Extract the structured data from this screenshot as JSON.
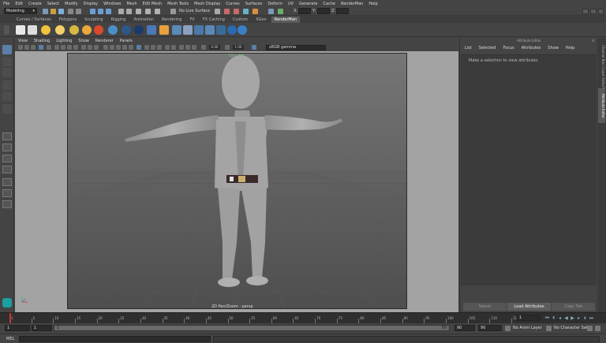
{
  "menubar": [
    "File",
    "Edit",
    "Create",
    "Select",
    "Modify",
    "Display",
    "Windows",
    "Mesh",
    "Edit Mesh",
    "Mesh Tools",
    "Mesh Display",
    "Curves",
    "Surfaces",
    "Deform",
    "UV",
    "Generate",
    "Cache",
    "RenderMan",
    "Help"
  ],
  "statusline": {
    "mode": "Modeling",
    "live_surface": "No Live Surface",
    "x_label": "X:",
    "y_label": "Y:",
    "z_label": "Z:"
  },
  "shelf": {
    "tabs": [
      "Curves / Surfaces",
      "Polygons",
      "Sculpting",
      "Rigging",
      "Animation",
      "Rendering",
      "FX",
      "FX Caching",
      "Custom",
      "XGen",
      "RenderMan"
    ],
    "active_tab": "RenderMan"
  },
  "panel": {
    "menu": [
      "View",
      "Shading",
      "Lighting",
      "Show",
      "Renderer",
      "Panels"
    ],
    "color_space": "sRGB gamma",
    "exposure": "0.00",
    "gamma": "1.00",
    "resolution_label": "720 x 480",
    "camera_label": "2D Pan/Zoom : persp"
  },
  "attribute_editor": {
    "title": "Attribute Editor",
    "menu": [
      "List",
      "Selected",
      "Focus",
      "Attributes",
      "Show",
      "Help"
    ],
    "message": "Make a selection to view attributes",
    "buttons": {
      "select": "Select",
      "load": "Load Attributes",
      "copy": "Copy Tab"
    }
  },
  "side_tabs": [
    "Channel Box / Layer Editor",
    "Modeling Toolkit",
    "Attribute Editor"
  ],
  "time_slider": {
    "ticks": [
      "1",
      "5",
      "10",
      "15",
      "20",
      "25",
      "30",
      "35",
      "40",
      "45",
      "50",
      "55",
      "60",
      "65",
      "70",
      "75",
      "80",
      "85",
      "90",
      "95",
      "100",
      "105",
      "110",
      "115"
    ],
    "current_frame": "1"
  },
  "range": {
    "start": "1",
    "anim_start": "1",
    "slider_start": "1",
    "slider_end": "90",
    "range_end": "90",
    "anim_end": "90",
    "anim_layer": "No Anim Layer",
    "char_set": "No Character Set"
  },
  "cmdline": {
    "label": "MEL"
  },
  "colors": {
    "accent": "#5b7fa6",
    "background": "#444444",
    "viewport": "#6e6e6e"
  }
}
